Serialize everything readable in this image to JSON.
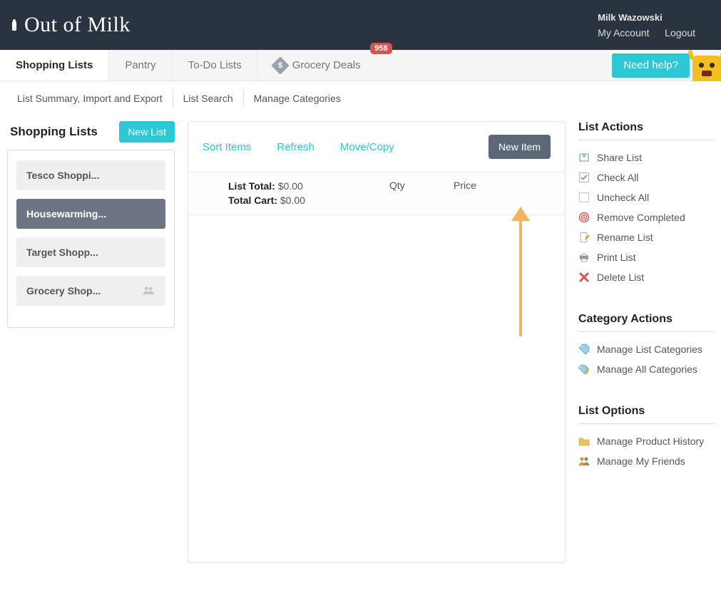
{
  "header": {
    "brand": "Out of Milk",
    "username": "Milk Wazowski",
    "my_account": "My Account",
    "logout": "Logout"
  },
  "nav": {
    "tabs": {
      "shopping": "Shopping Lists",
      "pantry": "Pantry",
      "todo": "To-Do Lists",
      "grocery": "Grocery Deals"
    },
    "grocery_badge": "958",
    "need_help": "Need help?"
  },
  "subnav": {
    "summary": "List Summary, Import and Export",
    "search": "List Search",
    "manage": "Manage Categories"
  },
  "left": {
    "title": "Shopping Lists",
    "new_list": "New List",
    "items": [
      {
        "label": "Tesco Shoppi...",
        "active": false,
        "shared": false
      },
      {
        "label": "Housewarming...",
        "active": true,
        "shared": false
      },
      {
        "label": "Target Shopp...",
        "active": false,
        "shared": false
      },
      {
        "label": "Grocery Shop...",
        "active": false,
        "shared": true
      }
    ]
  },
  "center": {
    "toolbar": {
      "sort": "Sort Items",
      "refresh": "Refresh",
      "move": "Move/Copy",
      "new_item": "New Item"
    },
    "list_head": {
      "list_total_label": "List Total:",
      "list_total_value": "$0.00",
      "total_cart_label": "Total Cart:",
      "total_cart_value": "$0.00",
      "qty": "Qty",
      "price": "Price"
    }
  },
  "right": {
    "list_actions_title": "List Actions",
    "list_actions": {
      "share": "Share List",
      "check_all": "Check All",
      "uncheck_all": "Uncheck All",
      "remove_completed": "Remove Completed",
      "rename": "Rename List",
      "print": "Print List",
      "delete": "Delete List"
    },
    "category_actions_title": "Category Actions",
    "category_actions": {
      "manage_list": "Manage List Categories",
      "manage_all": "Manage All Categories"
    },
    "list_options_title": "List Options",
    "list_options": {
      "product_history": "Manage Product History",
      "friends": "Manage My Friends"
    }
  }
}
